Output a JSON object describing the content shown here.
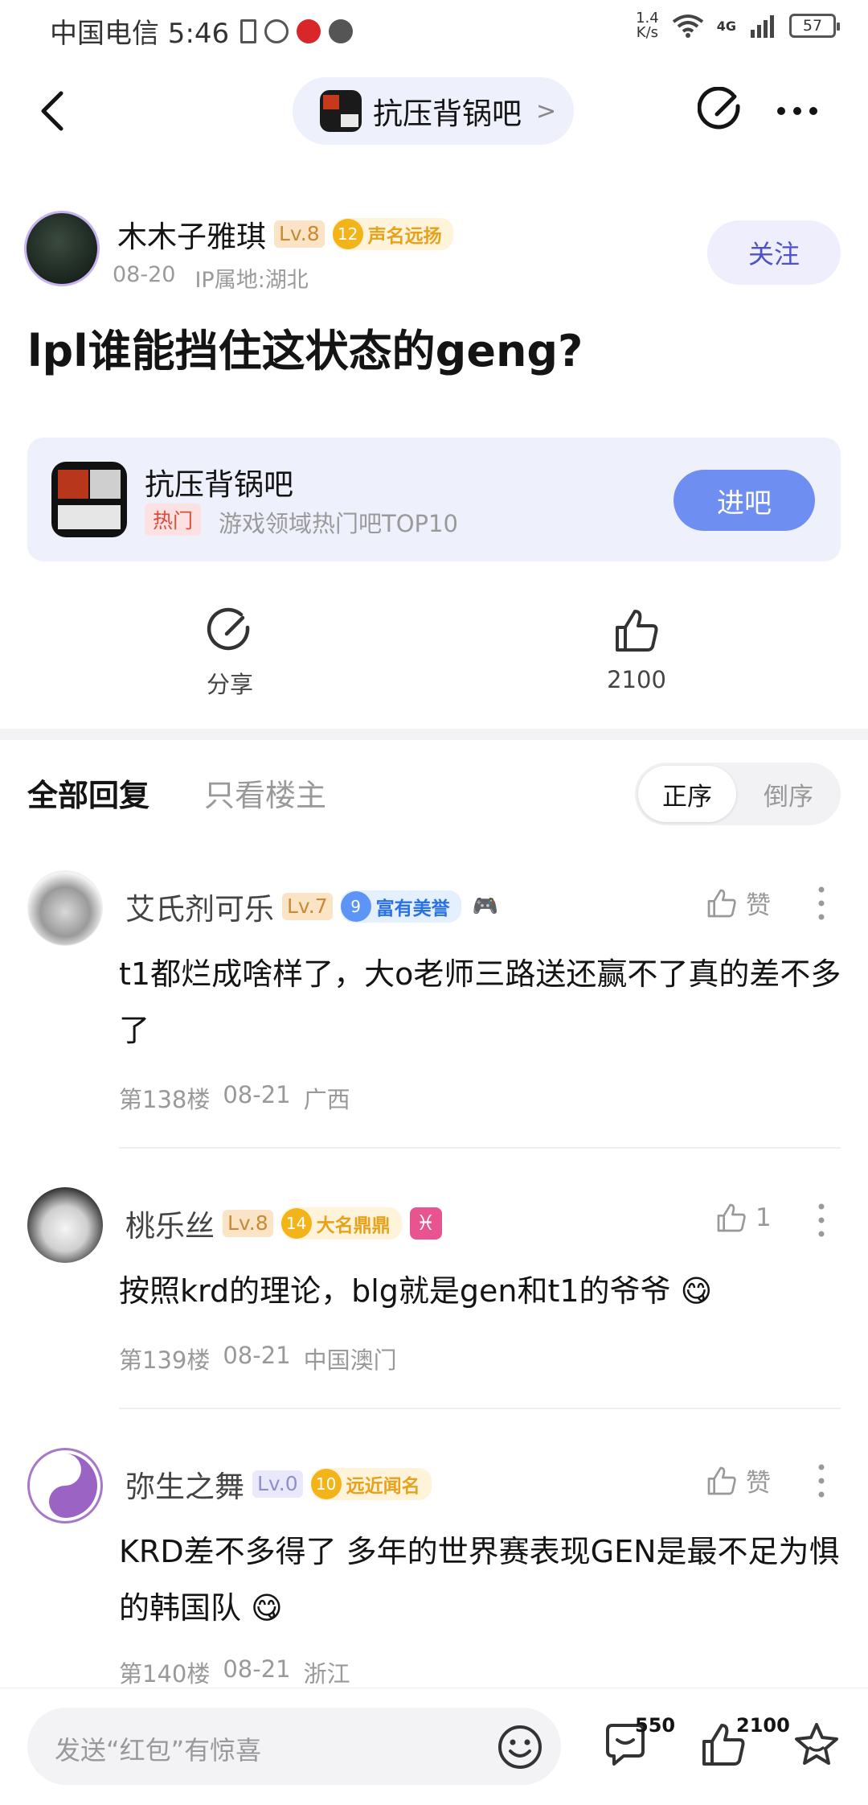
{
  "status_bar": {
    "carrier_time": "中国电信 5:46",
    "speed_value": "1.4",
    "speed_unit": "K/s",
    "network": "4G",
    "battery": "57"
  },
  "nav": {
    "forum_name": "抗压背锅吧",
    "chevron": ">"
  },
  "post": {
    "author": {
      "name": "木木子雅琪",
      "level": "Lv.8",
      "honor_level": "12",
      "honor_title": "声名远扬",
      "date": "08-20",
      "ip": "IP属地:湖北"
    },
    "follow_label": "关注",
    "title": "lpl谁能挡住这状态的geng?"
  },
  "forum_card": {
    "name": "抗压背锅吧",
    "hot_tag": "热门",
    "description": "游戏领域热门吧TOP10",
    "enter_label": "进吧"
  },
  "actions": {
    "share_label": "分享",
    "like_count": "2100"
  },
  "tabs": {
    "all": "全部回复",
    "owner_only": "只看楼主",
    "sort_asc": "正序",
    "sort_desc": "倒序"
  },
  "replies": [
    {
      "name": "艾氏剂可乐",
      "level": "Lv.7",
      "honor_level": "9",
      "honor_title": "富有美誉",
      "like": "赞",
      "text": "t1都烂成啥样了，大o老师三路送还赢不了真的差不多了",
      "floor": "第138楼",
      "date": "08-21",
      "location": "广西"
    },
    {
      "name": "桃乐丝",
      "level": "Lv.8",
      "honor_level": "14",
      "honor_title": "大名鼎鼎",
      "badge": "♓",
      "like": "1",
      "text": "按照krd的理论，blg就是gen和t1的爷爷 😋",
      "floor": "第139楼",
      "date": "08-21",
      "location": "中国澳门"
    },
    {
      "name": "弥生之舞",
      "level": "Lv.0",
      "honor_level": "10",
      "honor_title": "远近闻名",
      "like": "赞",
      "text": "KRD差不多得了 多年的世界赛表现GEN是最不足为惧的韩国队 😋",
      "floor": "第140楼",
      "date": "08-21",
      "location": "浙江"
    }
  ],
  "bottom_bar": {
    "placeholder": "发送“红包”有惊喜",
    "comment_count": "550",
    "like_count": "2100"
  }
}
